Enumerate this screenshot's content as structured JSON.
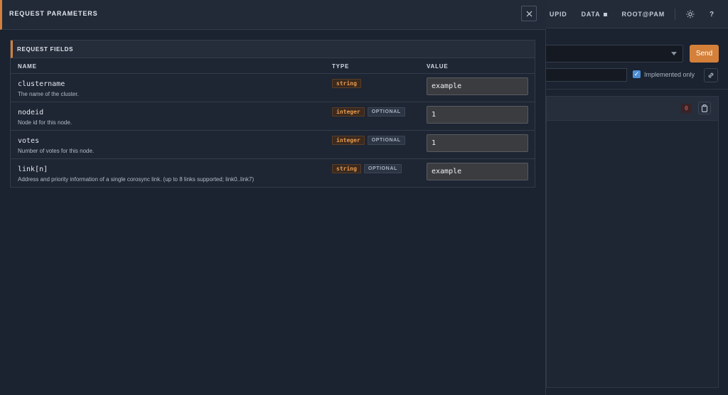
{
  "topbar": {
    "nav": [
      "UPID",
      "DATA",
      "ROOT@PAM"
    ],
    "help_label": "?"
  },
  "request": {
    "send_label": "Send",
    "implemented_only_label": "Implemented only",
    "implemented_only_checked": true,
    "result_count": "0"
  },
  "modal": {
    "title": "REQUEST PARAMETERS",
    "section_title": "REQUEST FIELDS",
    "columns": {
      "name": "NAME",
      "type": "TYPE",
      "value": "VALUE"
    },
    "fields": [
      {
        "name": "clustername",
        "description": "The name of the cluster.",
        "type": "string",
        "optional": "",
        "value": "example"
      },
      {
        "name": "nodeid",
        "description": "Node id for this node.",
        "type": "integer",
        "optional": "OPTIONAL",
        "value": "1"
      },
      {
        "name": "votes",
        "description": "Number of votes for this node.",
        "type": "integer",
        "optional": "OPTIONAL",
        "value": "1"
      },
      {
        "name": "link[n]",
        "description": "Address and priority information of a single corosync link. (up to 8 links supported; link0..link7)",
        "type": "string",
        "optional": "OPTIONAL",
        "value": "example"
      }
    ]
  },
  "colors": {
    "accent": "#d4803a",
    "background": "#1b2230",
    "panel": "#222a37",
    "checkbox": "#4d8fd6"
  }
}
